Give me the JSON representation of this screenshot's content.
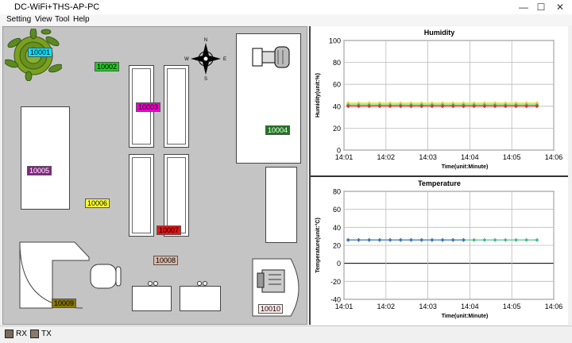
{
  "window": {
    "title": "DC-WiFi+THS-AP-PC",
    "minimize": "—",
    "maximize": "☐",
    "close": "✕"
  },
  "menu": [
    "Setting",
    "View",
    "Tool",
    "Help"
  ],
  "compass": {
    "n": "N",
    "s": "S",
    "e": "E",
    "w": "W"
  },
  "sensors": [
    {
      "id": "10001",
      "color": "#00e5ff"
    },
    {
      "id": "10002",
      "color": "#22cc22"
    },
    {
      "id": "10003",
      "color": "#ee00cc"
    },
    {
      "id": "10004",
      "color": "#1a7a1a"
    },
    {
      "id": "10005",
      "color": "#882288"
    },
    {
      "id": "10006",
      "color": "#ffff33"
    },
    {
      "id": "10007",
      "color": "#ee1111"
    },
    {
      "id": "10008",
      "color": "#ddb8a8"
    },
    {
      "id": "10009",
      "color": "#887700"
    },
    {
      "id": "10010",
      "color": "#ffe8e8"
    }
  ],
  "status": {
    "rx": "RX",
    "tx": "TX",
    "rx_color": "#7a6a5a",
    "tx_color": "#8a7a6a"
  },
  "chart_data": [
    {
      "type": "line",
      "title": "Humidity",
      "xlabel": "Time(unit:Minute)",
      "ylabel": "Humidity(unit:%)",
      "ylim": [
        0,
        100
      ],
      "yticks": [
        0,
        20,
        40,
        60,
        80,
        100
      ],
      "xticks": [
        "14:01",
        "14:02",
        "14:03",
        "14:04",
        "14:05",
        "14:06"
      ],
      "grid": true,
      "x": [
        0.1,
        0.35,
        0.6,
        0.85,
        1.1,
        1.35,
        1.6,
        1.85,
        2.1,
        2.35,
        2.6,
        2.85,
        3.1,
        3.35,
        3.6,
        3.85,
        4.1,
        4.35,
        4.6
      ],
      "series": [
        {
          "color": "#e8e84a",
          "values": [
            43,
            43,
            43,
            43,
            43,
            43,
            43,
            43,
            43,
            43,
            43,
            43,
            43,
            43,
            43,
            43,
            43,
            43,
            43
          ]
        },
        {
          "color": "#d0d060",
          "values": [
            42,
            42,
            42,
            42,
            42,
            42,
            42,
            42,
            42,
            42,
            42,
            42,
            42,
            42,
            42,
            42,
            42,
            42,
            42
          ]
        },
        {
          "color": "#33cc88",
          "values": [
            41,
            41,
            41,
            41,
            41,
            41,
            41,
            41,
            41,
            41,
            41,
            41,
            41,
            41,
            41,
            41,
            41,
            41,
            41
          ]
        },
        {
          "color": "#dd3333",
          "values": [
            40,
            40,
            40,
            40,
            40,
            40,
            40,
            40,
            40,
            40,
            40,
            40,
            40,
            40,
            40,
            40,
            40,
            40,
            40
          ]
        }
      ]
    },
    {
      "type": "line",
      "title": "Temperature",
      "xlabel": "Time(unit:Minute)",
      "ylabel": "Temperature(unit:°C)",
      "ylim": [
        -40,
        80
      ],
      "yticks": [
        -40,
        -20,
        0,
        20,
        40,
        60,
        80
      ],
      "xticks": [
        "14:01",
        "14:02",
        "14:03",
        "14:04",
        "14:05",
        "14:06"
      ],
      "grid": true,
      "x": [
        0.1,
        0.35,
        0.6,
        0.85,
        1.1,
        1.35,
        1.6,
        1.85,
        2.1,
        2.35,
        2.6,
        2.85,
        3.1,
        3.35,
        3.6,
        3.85,
        4.1,
        4.35,
        4.6
      ],
      "series": [
        {
          "color": "#44bb88",
          "values": [
            26,
            26,
            26,
            26,
            26,
            26,
            26,
            26,
            26,
            26,
            26,
            26,
            26,
            26,
            26,
            26,
            26,
            26,
            26
          ]
        },
        {
          "color": "#4477bb",
          "values": [
            26,
            26,
            26,
            26,
            26,
            26,
            26,
            26,
            26,
            26,
            26,
            26,
            null,
            null,
            null,
            null,
            null,
            null,
            null
          ]
        }
      ]
    }
  ]
}
